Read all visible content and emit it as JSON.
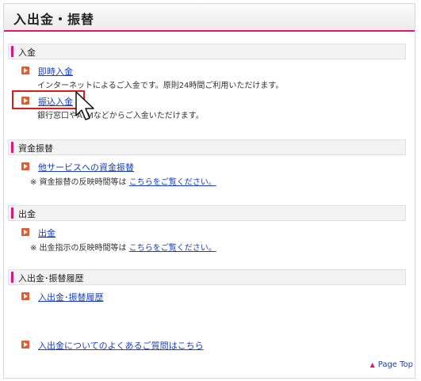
{
  "header": {
    "title": "入出金・振替"
  },
  "sections": {
    "deposit": {
      "heading": "入金",
      "instant": {
        "link": "即時入金",
        "desc": "インターネットによるご入金です。原則24時間ご利用いただけます。"
      },
      "transfer_in": {
        "link": "振込入金",
        "desc": "銀行窓口やATMなどからご入金いただけます。"
      }
    },
    "fund_transfer": {
      "heading": "資金振替",
      "link": "他サービスへの資金振替",
      "note_prefix": "※ 資金振替の反映時間等は",
      "note_link": "こちらをご覧ください。"
    },
    "withdrawal": {
      "heading": "出金",
      "link": "出金",
      "note_prefix": "※ 出金指示の反映時間等は",
      "note_link": "こちらをご覧ください。"
    },
    "history": {
      "heading": "入出金･振替履歴",
      "link": "入出金･振替履歴"
    }
  },
  "faq": {
    "link": "入出金についてのよくあるご質問はこちら"
  },
  "footer": {
    "page_top": "Page Top"
  },
  "colors": {
    "accent": "#e0147b",
    "link": "#1a3ec7",
    "arrow": "#e45a2a",
    "highlight": "#e01919"
  },
  "icons": {
    "bullet": "arrow-bullet-icon",
    "cursor": "mouse-cursor-icon",
    "page_top": "triangle-up-icon"
  }
}
